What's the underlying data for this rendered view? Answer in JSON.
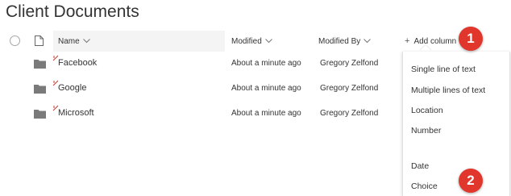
{
  "page": {
    "title": "Client Documents"
  },
  "header": {
    "name": "Name",
    "modified": "Modified",
    "modified_by": "Modified By",
    "add_column": "Add column"
  },
  "rows": [
    {
      "name": "Facebook",
      "modified": "About a minute ago",
      "modified_by": "Gregory Zelfond"
    },
    {
      "name": "Google",
      "modified": "About a minute ago",
      "modified_by": "Gregory Zelfond"
    },
    {
      "name": "Microsoft",
      "modified": "About a minute ago",
      "modified_by": "Gregory Zelfond"
    }
  ],
  "menu": {
    "items": [
      "Single line of text",
      "Multiple lines of text",
      "Location",
      "Number",
      "Date",
      "Choice"
    ]
  },
  "badges": [
    "1",
    "2"
  ],
  "colors": {
    "badge": "#e0362b",
    "header_bg": "#f4f4f4",
    "folder": "#7a7a7a"
  },
  "icons": [
    "circle-check-icon",
    "document-icon",
    "chevron-down-icon",
    "plus-icon",
    "folder-icon",
    "new-item-icon"
  ]
}
